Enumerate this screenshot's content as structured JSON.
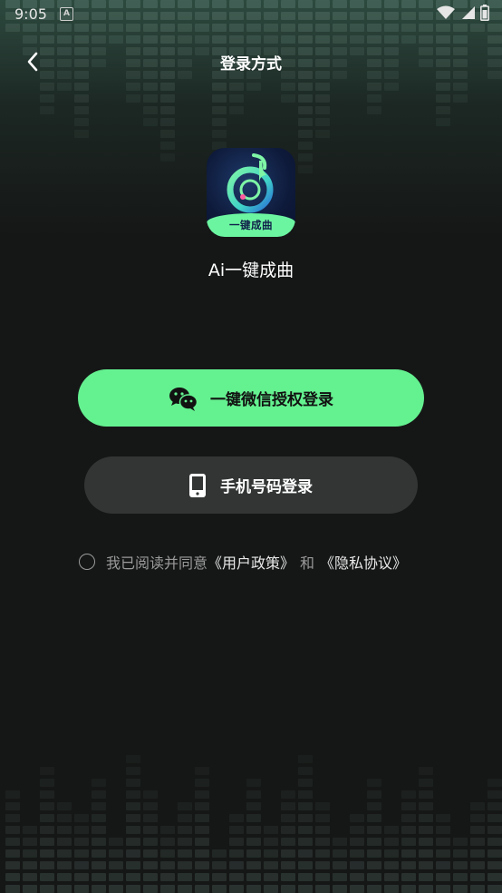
{
  "status_bar": {
    "time": "9:05",
    "notification_icon": "a-box-icon",
    "icons": [
      "wifi-icon",
      "signal-icon",
      "battery-icon"
    ]
  },
  "nav": {
    "back_icon": "chevron-left-icon",
    "title": "登录方式"
  },
  "app": {
    "icon_label": "一键成曲",
    "name": "Ai一键成曲"
  },
  "buttons": {
    "wechat_label": "一键微信授权登录",
    "wechat_icon": "wechat-icon",
    "phone_label": "手机号码登录",
    "phone_icon": "mobile-phone-icon"
  },
  "agreement": {
    "prefix": "我已阅读并同意",
    "user_policy": "《用户政策》",
    "and": "和",
    "privacy_policy": "《隐私协议》"
  },
  "colors": {
    "background": "#151716",
    "accent_green": "#64f190",
    "secondary_button": "#333535",
    "muted_text": "#9a9a9a"
  }
}
